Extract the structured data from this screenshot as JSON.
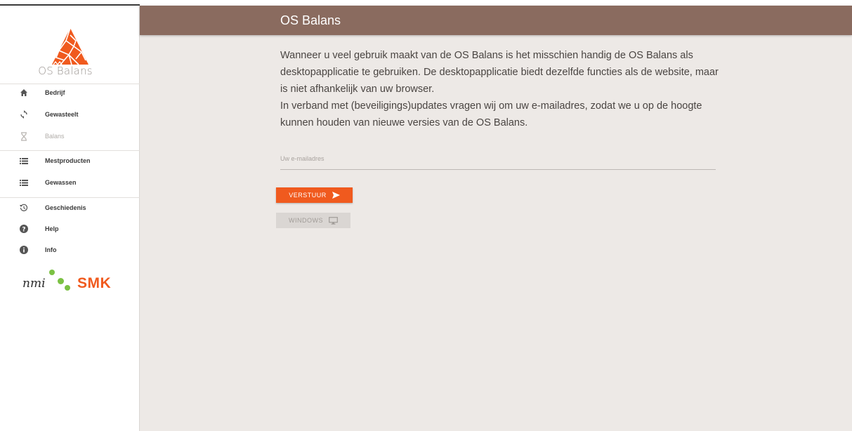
{
  "app": {
    "logo_text": "OS Balans",
    "brand_color": "#f05a1e",
    "header_color": "#8a6b5f"
  },
  "header": {
    "title": "OS Balans"
  },
  "sidebar": {
    "items": [
      {
        "label": "Bedrijf",
        "icon": "home-icon"
      },
      {
        "label": "Gewasteelt",
        "icon": "sync-icon"
      },
      {
        "label": "Balans",
        "icon": "hourglass-icon",
        "disabled": true
      },
      {
        "label": "Mestproducten",
        "icon": "list-icon"
      },
      {
        "label": "Gewassen",
        "icon": "list-icon"
      },
      {
        "label": "Geschiedenis",
        "icon": "history-icon"
      },
      {
        "label": "Help",
        "icon": "help-icon"
      },
      {
        "label": "Info",
        "icon": "info-icon"
      }
    ],
    "partners": {
      "nmi": "nmi",
      "smk": "SMK"
    }
  },
  "main": {
    "paragraph1": "Wanneer u veel gebruik maakt van de OS Balans is het misschien handig de OS Balans als desktopapplicatie te gebruiken. De desktopapplicatie biedt dezelfde functies als de website, maar is niet afhankelijk van uw browser.",
    "paragraph2": "In verband met (beveiligings)updates vragen wij om uw e-mailadres, zodat we u op de hoogte kunnen houden van nieuwe versies van de OS Balans.",
    "email": {
      "placeholder": "Uw e-mailadres",
      "value": ""
    },
    "send_button": "VERSTUUR",
    "windows_button": "WINDOWS"
  }
}
